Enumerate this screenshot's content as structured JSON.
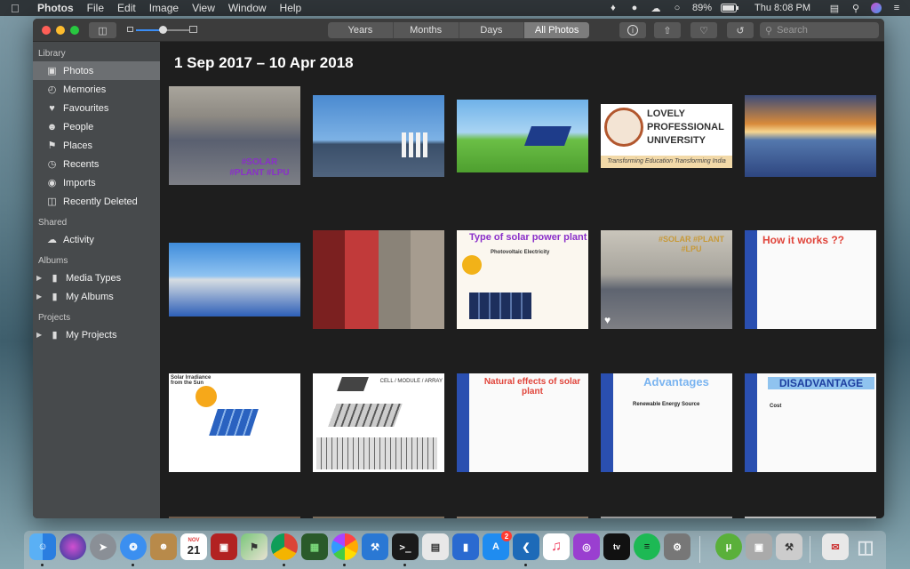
{
  "menubar": {
    "app_name": "Photos",
    "menus": [
      "File",
      "Edit",
      "Image",
      "View",
      "Window",
      "Help"
    ],
    "battery": "89%",
    "clock": "Thu 8:08 PM"
  },
  "toolbar": {
    "zoom_level": 0.5,
    "segments": [
      "Years",
      "Months",
      "Days",
      "All Photos"
    ],
    "active_segment": "All Photos",
    "search_placeholder": "Search"
  },
  "sidebar": {
    "library_header": "Library",
    "library_items": [
      {
        "label": "Photos",
        "icon": "photos-icon",
        "selected": true
      },
      {
        "label": "Memories",
        "icon": "memories-icon"
      },
      {
        "label": "Favourites",
        "icon": "heart-icon"
      },
      {
        "label": "People",
        "icon": "person-icon"
      },
      {
        "label": "Places",
        "icon": "pin-icon"
      },
      {
        "label": "Recents",
        "icon": "clock-icon"
      },
      {
        "label": "Imports",
        "icon": "camera-icon"
      },
      {
        "label": "Recently Deleted",
        "icon": "trash-icon"
      }
    ],
    "shared_header": "Shared",
    "shared_items": [
      {
        "label": "Activity",
        "icon": "cloud-icon"
      }
    ],
    "albums_header": "Albums",
    "album_items": [
      {
        "label": "Media Types",
        "icon": "folder-icon"
      },
      {
        "label": "My Albums",
        "icon": "folder-icon"
      }
    ],
    "projects_header": "Projects",
    "project_items": [
      {
        "label": "My Projects",
        "icon": "folder-icon"
      }
    ]
  },
  "main": {
    "date_range": "1 Sep 2017 – 10 Apr 2018",
    "photos": [
      {
        "kind": "solar-roof",
        "caption": "#SOLAR #PLANT #LPU"
      },
      {
        "kind": "solar-people",
        "caption": ""
      },
      {
        "kind": "solar-field",
        "caption": ""
      },
      {
        "kind": "lpu-logo",
        "caption": "LOVELY PROFESSIONAL UNIVERSITY",
        "subcaption": "Transforming Education Transforming India"
      },
      {
        "kind": "solar-sunset",
        "caption": ""
      },
      {
        "kind": "solar-building",
        "caption": ""
      },
      {
        "kind": "inverters",
        "caption": ""
      },
      {
        "kind": "slide",
        "caption": "Type of solar power plant",
        "subcaption": "Photovoltaic Electricity"
      },
      {
        "kind": "solar-roof-2",
        "caption": "#SOLAR #PLANT #LPU",
        "favourite": true
      },
      {
        "kind": "slide-blue",
        "caption": "How it works ??"
      },
      {
        "kind": "diagram",
        "caption": "Solar Irradiance from the Sun"
      },
      {
        "kind": "cell-diagram",
        "caption": "CELL / MODULE / ARRAY"
      },
      {
        "kind": "slide-blue",
        "caption": "Natural effects of solar plant"
      },
      {
        "kind": "slide-blue",
        "caption": "Advantages",
        "subcaption": "Renewable Energy Source"
      },
      {
        "kind": "slide-blue",
        "caption": "DISADVANTAGE",
        "subcaption": "Cost"
      }
    ]
  },
  "dock": {
    "apps": [
      "Finder",
      "Siri",
      "Launchpad",
      "Safari",
      "Contacts",
      "Calendar",
      "Photo Booth",
      "Maps",
      "Chrome",
      "Memory",
      "Photos",
      "Xcode",
      "Terminal",
      "Preview",
      "Keynote",
      "App Store",
      "VS Code",
      "Music",
      "Podcasts",
      "TV",
      "Spotify",
      "System Preferences",
      "uTorrent",
      "Image Capture",
      "Migration",
      "Mail",
      "Trash"
    ],
    "calendar_month": "NOV",
    "calendar_day": "21",
    "appstore_badge": "2"
  }
}
